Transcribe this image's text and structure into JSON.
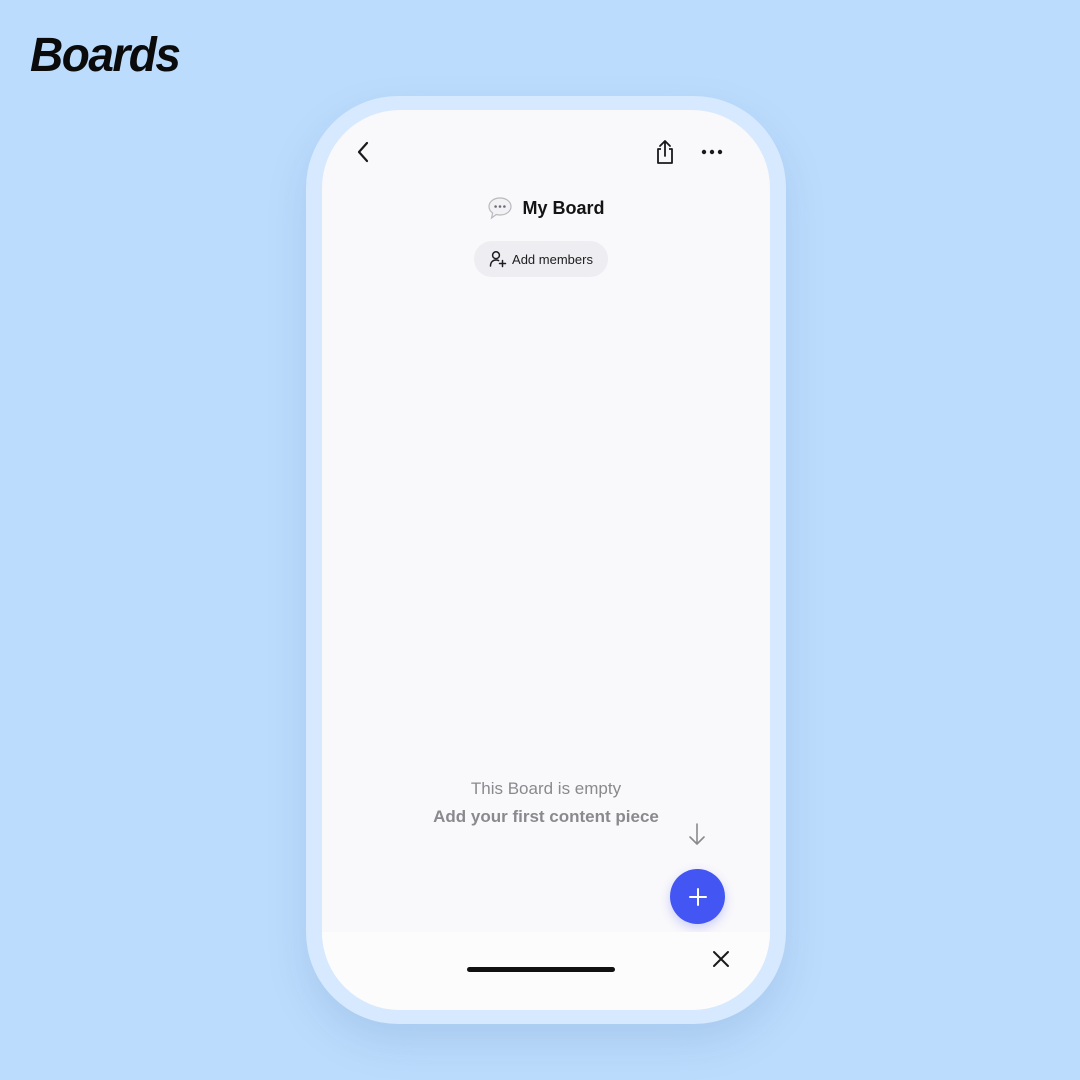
{
  "brand": {
    "name": "Boards"
  },
  "header": {
    "back_icon": "chevron-left-icon",
    "share_icon": "share-icon",
    "more_icon": "more-horizontal-icon"
  },
  "board": {
    "icon": "speech-bubble-icon",
    "title": "My Board",
    "add_members_label": "Add members",
    "add_members_icon": "add-person-icon"
  },
  "empty_state": {
    "title": "This Board is empty",
    "subtitle": "Add your first content piece",
    "hint_icon": "arrow-down-icon"
  },
  "fab": {
    "icon": "plus-icon"
  },
  "bottom_bar": {
    "close_icon": "close-icon"
  },
  "colors": {
    "background": "#bcdcfd",
    "phone_frame": "#d6e9fe",
    "screen": "#f9f8fb",
    "accent": "#4355f2",
    "muted_text": "#8a8a8e",
    "pill": "#eeedf1"
  }
}
